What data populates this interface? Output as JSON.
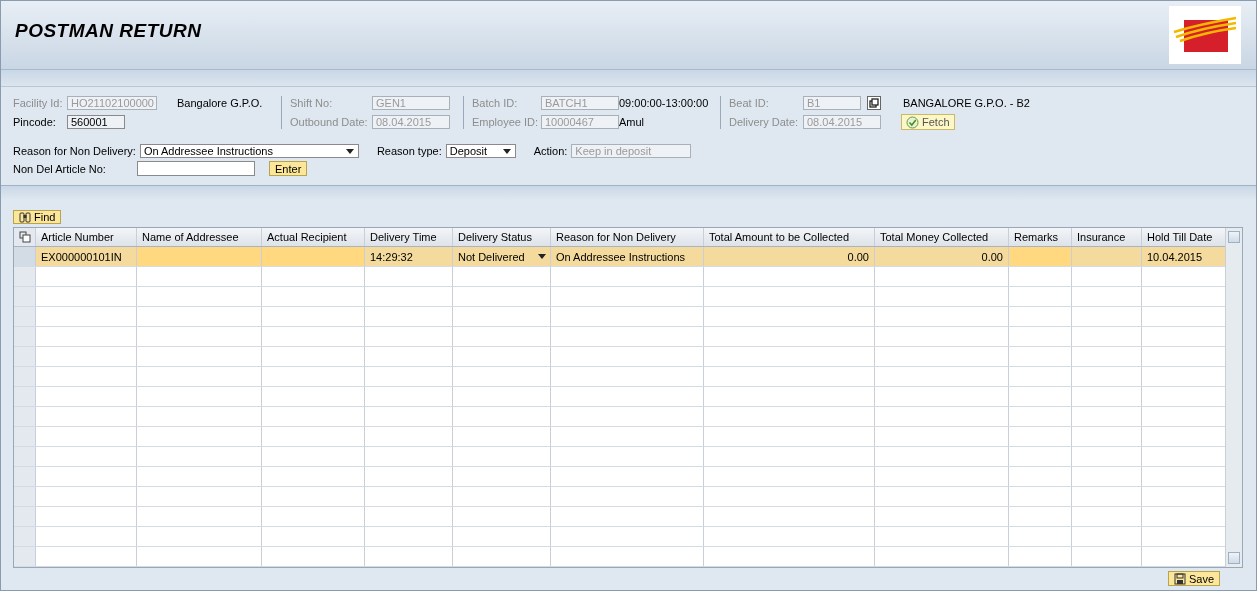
{
  "header": {
    "title": "POSTMAN RETURN"
  },
  "groups": [
    {
      "fields": [
        {
          "label": "Facility Id:",
          "value": "HO21102100000",
          "disabled": true,
          "note": "Bangalore G.P.O."
        },
        {
          "label": "Pincode:",
          "value": "560001",
          "disabled": false
        }
      ]
    },
    {
      "fields": [
        {
          "label": "Shift No:",
          "value": "GEN1",
          "disabled": true
        },
        {
          "label": "Outbound Date:",
          "value": "08.04.2015",
          "disabled": true
        }
      ]
    },
    {
      "fields": [
        {
          "label": "Batch ID:",
          "value": "BATCH1",
          "disabled": true,
          "note": "09:00:00-13:00:00"
        },
        {
          "label": "Employee ID:",
          "value": "10000467",
          "disabled": true,
          "note": "Amul"
        }
      ]
    },
    {
      "fields": [
        {
          "label": "Beat ID:",
          "value": "B1",
          "disabled": true,
          "note": "BANGALORE G.P.O. - B2",
          "help": true
        },
        {
          "label": "Delivery Date:",
          "value": "08.04.2015",
          "disabled": true,
          "button": "Fetch"
        }
      ]
    }
  ],
  "reason": {
    "label": "Reason for Non Delivery:",
    "value": "On Addressee Instructions"
  },
  "reason_type": {
    "label": "Reason type:",
    "value": "Deposit"
  },
  "action": {
    "label": "Action:",
    "placeholder": "Keep in deposit"
  },
  "article": {
    "label": "Non Del Article No:",
    "button": "Enter"
  },
  "find_button": "Find",
  "table": {
    "columns": [
      {
        "label": "Article Number",
        "editable": false
      },
      {
        "label": "Name of Addressee",
        "editable": true
      },
      {
        "label": "Actual Recipient",
        "editable": true
      },
      {
        "label": "Delivery Time",
        "editable": false
      },
      {
        "label": "Delivery Status",
        "editable": false
      },
      {
        "label": "Reason for Non Delivery",
        "editable": false
      },
      {
        "label": "Total Amount to be Collected",
        "editable": false
      },
      {
        "label": "Total Money Collected",
        "editable": false
      },
      {
        "label": "Remarks",
        "editable": true
      },
      {
        "label": "Insurance",
        "editable": false
      },
      {
        "label": "Hold Till Date",
        "editable": false
      }
    ],
    "rows": [
      {
        "selected": true,
        "cells": [
          "EX000000101IN",
          "",
          "",
          "14:29:32",
          "Not Delivered",
          "On Addressee Instructions",
          "0.00",
          "0.00",
          "",
          "",
          "10.04.2015"
        ]
      }
    ]
  },
  "save_button": "Save"
}
